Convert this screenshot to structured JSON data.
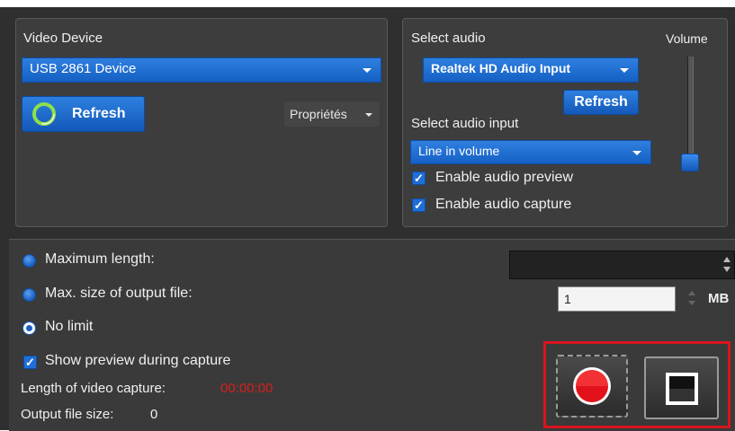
{
  "video": {
    "heading": "Video Device",
    "device": "USB 2861 Device",
    "refresh_label": "Refresh",
    "properties_label": "Propriétés"
  },
  "audio": {
    "heading": "Select audio",
    "device": "Realtek HD Audio Input",
    "refresh_label": "Refresh",
    "input_heading": "Select audio input",
    "input": "Line in volume",
    "preview_label": "Enable audio preview",
    "preview_checked": true,
    "capture_label": "Enable audio capture",
    "capture_checked": true,
    "volume_label": "Volume",
    "volume_level": 0.05
  },
  "capture": {
    "max_length_label": "Maximum length:",
    "max_length_value": "",
    "max_size_label": "Max. size of output file:",
    "max_size_value": "1",
    "max_size_unit": "MB",
    "no_limit_label": "No limit",
    "selected_limit": "no_limit",
    "show_preview_label": "Show preview during capture",
    "show_preview_checked": true,
    "length_label": "Length of video capture:",
    "length_value": "00:00:00",
    "output_size_label": "Output file size:",
    "output_size_value": "0"
  },
  "colors": {
    "accent": "#1f6fd6",
    "record": "#e3121a",
    "highlight_box": "#d9141f",
    "timer": "#d81e1e"
  },
  "icons": {
    "refresh": "refresh-icon",
    "record": "record-icon",
    "stop": "stop-icon"
  }
}
